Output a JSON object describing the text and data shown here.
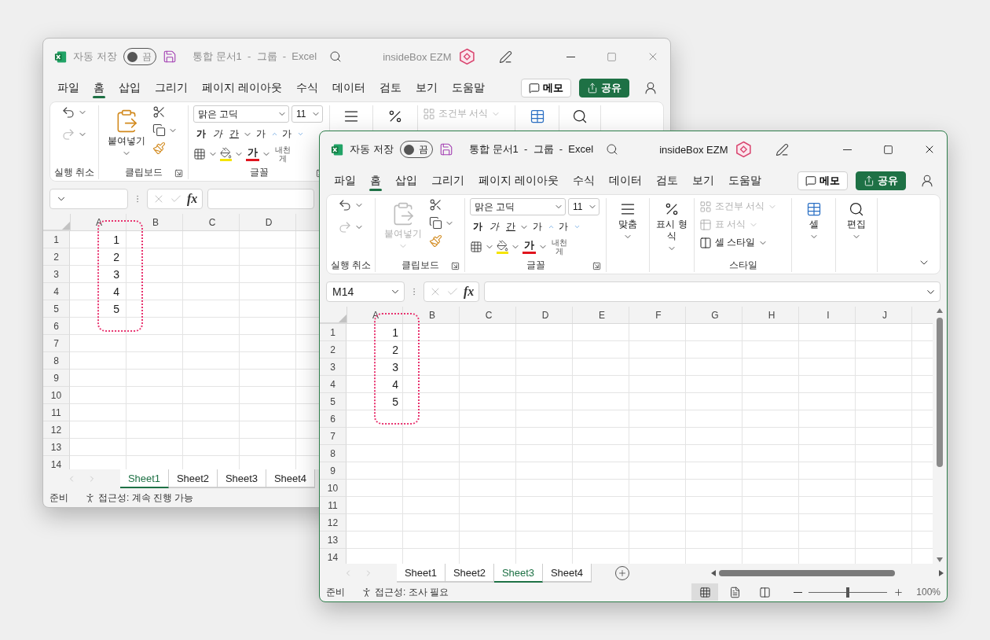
{
  "windows": [
    {
      "active": false,
      "title_bar": {
        "autosave_label": "자동 저장",
        "autosave_on": false,
        "autosave_state": "끔",
        "document_title": "통합 문서1  -  그룹  -  Excel",
        "account": "insideBox EZM"
      },
      "menu_tabs": [
        {
          "label": "파일",
          "selected": false
        },
        {
          "label": "홈",
          "selected": true
        },
        {
          "label": "삽입",
          "selected": false
        },
        {
          "label": "그리기",
          "selected": false
        },
        {
          "label": "페이지 레이아웃",
          "selected": false
        },
        {
          "label": "수식",
          "selected": false
        },
        {
          "label": "데이터",
          "selected": false
        },
        {
          "label": "검토",
          "selected": false
        },
        {
          "label": "보기",
          "selected": false
        },
        {
          "label": "도움말",
          "selected": false
        }
      ],
      "memo_button": "메모",
      "share_button": "공유",
      "ribbon": {
        "groups": [
          {
            "kind": "undo",
            "label": "실행 취소"
          },
          {
            "kind": "clipboard",
            "label": "클립보드",
            "paste": "붙여넣기",
            "disabled": false
          },
          {
            "kind": "font",
            "label": "글꼴",
            "font_name": "맑은 고딕",
            "font_size": "11",
            "style_buttons": [
              "가",
              "가",
              "간"
            ],
            "size_buttons": [
              "가",
              "가"
            ],
            "font_color": "가",
            "phonetic": [
              "내천",
              "게"
            ]
          },
          {
            "kind": "alignment"
          },
          {
            "kind": "number"
          },
          {
            "kind": "styles",
            "items": [
              {
                "label": "조건부 서식",
                "disabled": true
              }
            ]
          },
          {
            "kind": "cells"
          },
          {
            "kind": "editing"
          }
        ]
      },
      "formula_icon": "fx",
      "columns": [
        "A",
        "B",
        "C",
        "D"
      ],
      "rows": [
        {
          "header": "1",
          "value": "1"
        },
        {
          "header": "2",
          "value": "2"
        },
        {
          "header": "3",
          "value": "3"
        },
        {
          "header": "4",
          "value": "4"
        },
        {
          "header": "5",
          "value": "5"
        },
        {
          "header": "6"
        },
        {
          "header": "7"
        },
        {
          "header": "8"
        },
        {
          "header": "9"
        },
        {
          "header": "10"
        },
        {
          "header": "11"
        },
        {
          "header": "12"
        },
        {
          "header": "13"
        },
        {
          "header": "14"
        }
      ],
      "sheets": [
        {
          "label": "Sheet1",
          "selected": true
        },
        {
          "label": "Sheet2",
          "selected": false
        },
        {
          "label": "Sheet3",
          "selected": false
        },
        {
          "label": "Sheet4",
          "selected": false
        }
      ],
      "status": {
        "ready": "준비",
        "accessibility": "접근성: 계속 진행 가능"
      }
    },
    {
      "active": true,
      "title_bar": {
        "autosave_label": "자동 저장",
        "autosave_on": false,
        "autosave_state": "끔",
        "document_title": "통합 문서1  -  그룹  -  Excel",
        "account": "insideBox EZM"
      },
      "menu_tabs": [
        {
          "label": "파일",
          "selected": false
        },
        {
          "label": "홈",
          "selected": true
        },
        {
          "label": "삽입",
          "selected": false
        },
        {
          "label": "그리기",
          "selected": false
        },
        {
          "label": "페이지 레이아웃",
          "selected": false
        },
        {
          "label": "수식",
          "selected": false
        },
        {
          "label": "데이터",
          "selected": false
        },
        {
          "label": "검토",
          "selected": false
        },
        {
          "label": "보기",
          "selected": false
        },
        {
          "label": "도움말",
          "selected": false
        }
      ],
      "memo_button": "메모",
      "share_button": "공유",
      "ribbon": {
        "groups": [
          {
            "kind": "undo",
            "label": "실행 취소"
          },
          {
            "kind": "clipboard",
            "label": "클립보드",
            "paste": "붙여넣기",
            "disabled": true
          },
          {
            "kind": "font",
            "label": "글꼴",
            "font_name": "맑은 고딕",
            "font_size": "11",
            "style_buttons": [
              "가",
              "가",
              "간"
            ],
            "size_buttons": [
              "가",
              "가"
            ],
            "font_color": "가",
            "phonetic": [
              "내천",
              "게"
            ]
          },
          {
            "kind": "alignment",
            "label": "맞춤"
          },
          {
            "kind": "number",
            "label": "표시 형식"
          },
          {
            "kind": "styles",
            "label": "스타일",
            "items": [
              {
                "label": "조건부 서식",
                "disabled": true
              },
              {
                "label": "표 서식",
                "disabled": true
              },
              {
                "label": "셀 스타일",
                "disabled": false
              }
            ]
          },
          {
            "kind": "cells",
            "label": "셀"
          },
          {
            "kind": "editing",
            "label": "편집"
          }
        ]
      },
      "name_box": "M14",
      "formula_icon": "fx",
      "columns": [
        "A",
        "B",
        "C",
        "D",
        "E",
        "F",
        "G",
        "H",
        "I",
        "J"
      ],
      "rows": [
        {
          "header": "1",
          "value": "1"
        },
        {
          "header": "2",
          "value": "2"
        },
        {
          "header": "3",
          "value": "3"
        },
        {
          "header": "4",
          "value": "4"
        },
        {
          "header": "5",
          "value": "5"
        },
        {
          "header": "6"
        },
        {
          "header": "7"
        },
        {
          "header": "8"
        },
        {
          "header": "9"
        },
        {
          "header": "10"
        },
        {
          "header": "11"
        },
        {
          "header": "12"
        },
        {
          "header": "13"
        },
        {
          "header": "14"
        }
      ],
      "sheets": [
        {
          "label": "Sheet1",
          "selected": false
        },
        {
          "label": "Sheet2",
          "selected": false
        },
        {
          "label": "Sheet3",
          "selected": true
        },
        {
          "label": "Sheet4",
          "selected": false
        }
      ],
      "status": {
        "ready": "준비",
        "accessibility": "접근성: 조사 필요",
        "views": [
          {
            "selected": true
          },
          {
            "selected": false
          },
          {
            "selected": false
          }
        ],
        "zoom": {
          "level": 0.5,
          "label": "100%"
        }
      }
    }
  ]
}
